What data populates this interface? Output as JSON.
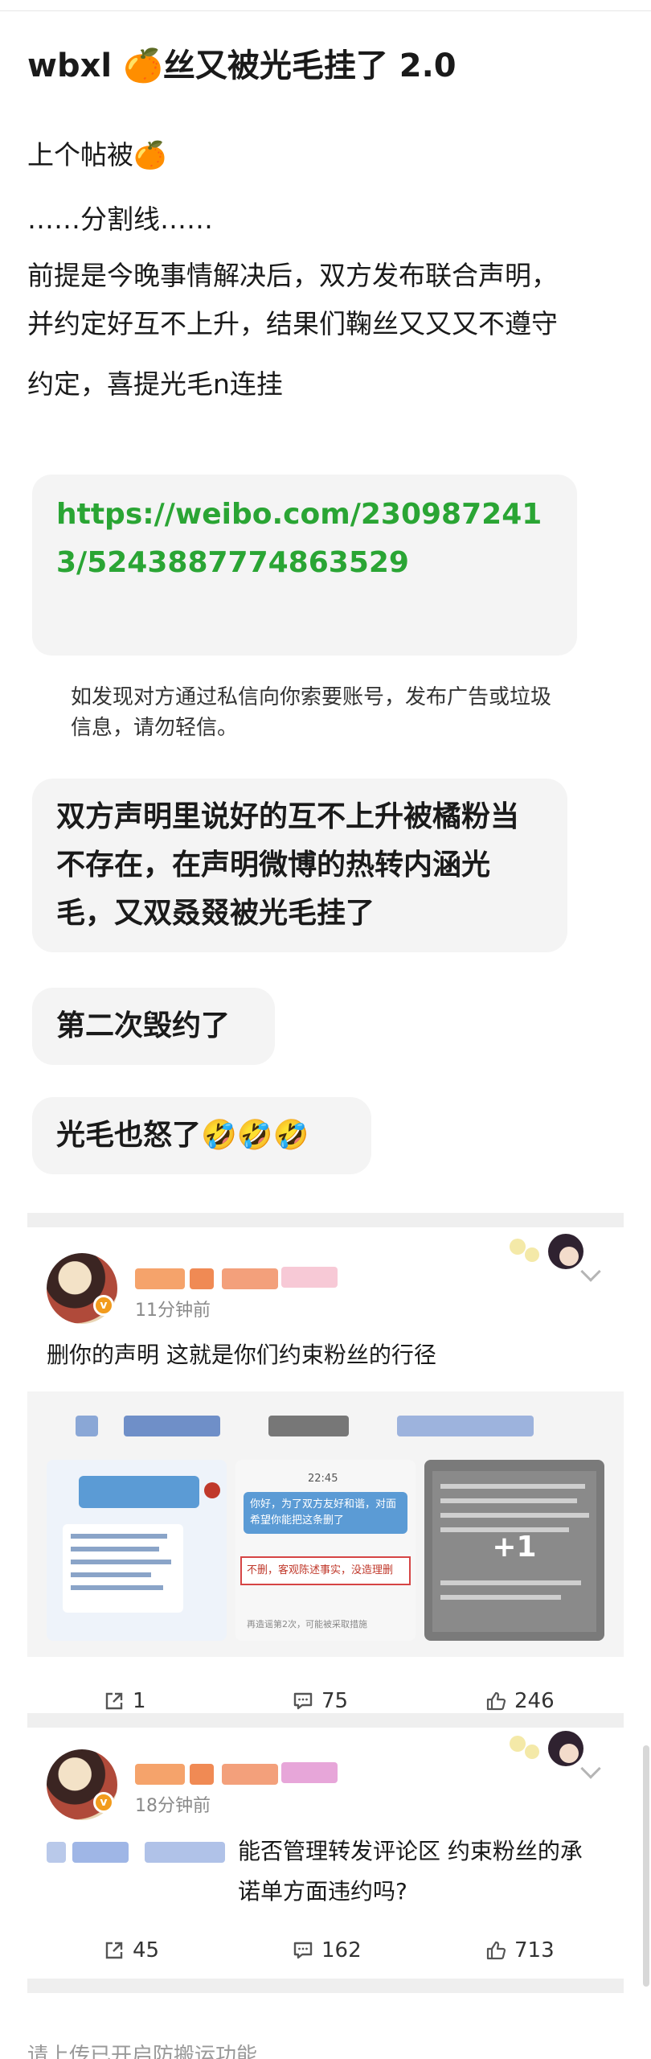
{
  "post": {
    "title": "wbxl 🍊丝又被光毛挂了 2.0",
    "lines": [
      "上个帖被🍊",
      "……分割线……",
      "前提是今晚事情解决后，双方发布联合声明，",
      "并约定好互不上升，结果们鞠丝又又又不遵守",
      "约定，喜提光毛n连挂"
    ],
    "link": "https://weibo.com/2309872413/5243887774863529",
    "notice": "如发现对方通过私信向你索要账号，发布广告或垃圾信息，请勿轻信。",
    "bubbles": [
      "双方声明里说好的互不上升被橘粉当不存在，在声明微博的热转内涵光毛，又双叒叕被光毛挂了",
      "第二次毁约了",
      "光毛也怒了🤣🤣🤣"
    ]
  },
  "comments": [
    {
      "time": "11分钟前",
      "text": "删你的声明 这就是你们约束粉丝的行径",
      "image_overlay": "+1",
      "thumb2": {
        "time": "22:45",
        "bubble": "你好，为了双方友好和谐，对面希望你能把这条删了",
        "quote": "不删，客观陈述事实，没造理删",
        "footer": "再造谣第2次，可能被采取措施"
      },
      "actions": {
        "share": "1",
        "comment": "75",
        "like": "246"
      }
    },
    {
      "time": "18分钟前",
      "text": "能否管理转发评论区 约束粉丝的承诺单方面违约吗?",
      "actions": {
        "share": "45",
        "comment": "162",
        "like": "713"
      }
    }
  ],
  "bottom_hint": "请上传已开启防搬运功能"
}
